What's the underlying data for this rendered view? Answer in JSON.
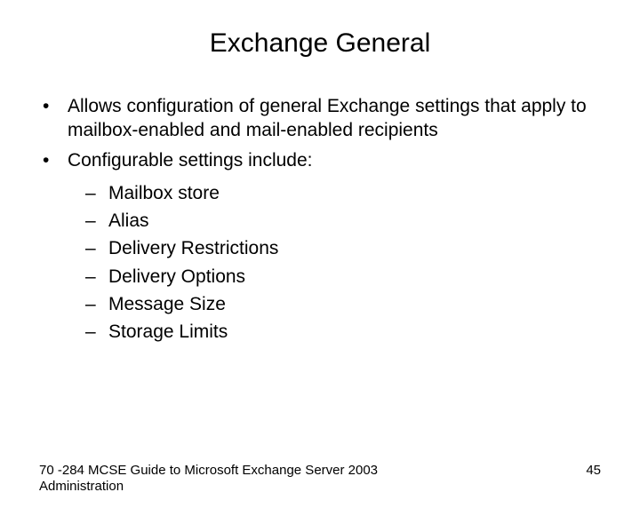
{
  "title": "Exchange General",
  "bullets": {
    "b0": "Allows configuration of general Exchange settings that apply to mailbox-enabled and mail-enabled recipients",
    "b1": "Configurable settings include:"
  },
  "sub": {
    "s0": "Mailbox store",
    "s1": "Alias",
    "s2": "Delivery Restrictions",
    "s3": "Delivery Options",
    "s4": "Message Size",
    "s5": "Storage Limits"
  },
  "footer": {
    "left": "70 -284 MCSE Guide to Microsoft Exchange Server 2003 Administration",
    "right": "45"
  }
}
